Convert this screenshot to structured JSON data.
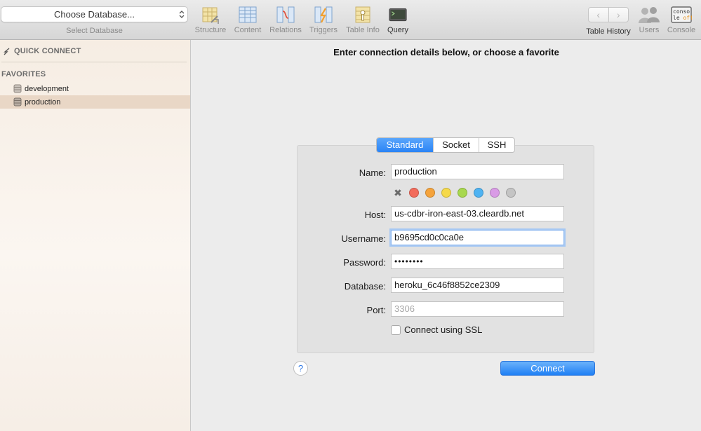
{
  "toolbar": {
    "database_select": {
      "value": "Choose Database...",
      "caption": "Select Database"
    },
    "buttons": [
      {
        "label": "Structure",
        "icon": "structure-icon"
      },
      {
        "label": "Content",
        "icon": "content-icon"
      },
      {
        "label": "Relations",
        "icon": "relations-icon"
      },
      {
        "label": "Triggers",
        "icon": "triggers-icon"
      },
      {
        "label": "Table Info",
        "icon": "table-info-icon"
      },
      {
        "label": "Query",
        "icon": "query-icon"
      }
    ],
    "right_buttons": [
      {
        "label": "Table History",
        "icon": "history-arrows"
      },
      {
        "label": "Users",
        "icon": "users-icon"
      },
      {
        "label": "Console",
        "icon": "console-icon",
        "icon_text": "conso le off"
      }
    ],
    "nav_back": "‹",
    "nav_forward": "›"
  },
  "sidebar": {
    "quick_connect": "QUICK CONNECT",
    "favorites_heading": "FAVORITES",
    "favorites": [
      {
        "label": "development",
        "selected": false
      },
      {
        "label": "production",
        "selected": true
      }
    ]
  },
  "main": {
    "title": "Enter connection details below, or choose a favorite",
    "tabs": [
      {
        "label": "Standard",
        "active": true
      },
      {
        "label": "Socket",
        "active": false
      },
      {
        "label": "SSH",
        "active": false
      }
    ],
    "fields": {
      "name": {
        "label": "Name:",
        "value": "production"
      },
      "host": {
        "label": "Host:",
        "value": "us-cdbr-iron-east-03.cleardb.net"
      },
      "username": {
        "label": "Username:",
        "value": "b9695cd0c0ca0e"
      },
      "password": {
        "label": "Password:",
        "value": "••••••••"
      },
      "database": {
        "label": "Database:",
        "value": "heroku_6c46f8852ce2309"
      },
      "port": {
        "label": "Port:",
        "placeholder": "3306"
      }
    },
    "color_tags": [
      "#f26b5b",
      "#f5a33b",
      "#f5d94a",
      "#a8d84e",
      "#4fb3f2",
      "#d99be6",
      "#c4c4c4"
    ],
    "ssl_label": "Connect using SSL",
    "ssl_checked": false,
    "help": "?",
    "connect_button": "Connect"
  },
  "colors": {
    "accent": "#2b84f5",
    "sidebar_selected": "#e9d7c6"
  }
}
